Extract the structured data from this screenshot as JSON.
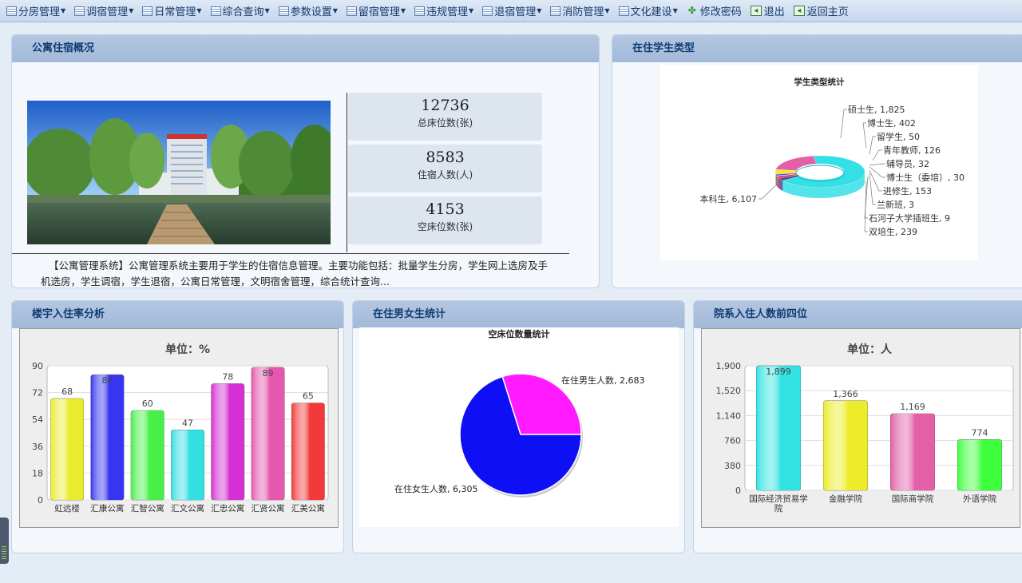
{
  "menu": [
    {
      "label": "分房管理",
      "dropdown": true,
      "icon": "list-icon"
    },
    {
      "label": "调宿管理",
      "dropdown": true,
      "icon": "list-icon"
    },
    {
      "label": "日常管理",
      "dropdown": true,
      "icon": "list-icon"
    },
    {
      "label": "综合查询",
      "dropdown": true,
      "icon": "list-icon"
    },
    {
      "label": "参数设置",
      "dropdown": true,
      "icon": "list-icon"
    },
    {
      "label": "留宿管理",
      "dropdown": true,
      "icon": "list-icon"
    },
    {
      "label": "违规管理",
      "dropdown": true,
      "icon": "list-icon"
    },
    {
      "label": "退宿管理",
      "dropdown": true,
      "icon": "list-icon"
    },
    {
      "label": "消防管理",
      "dropdown": true,
      "icon": "list-icon"
    },
    {
      "label": "文化建设",
      "dropdown": true,
      "icon": "list-icon"
    },
    {
      "label": "修改密码",
      "dropdown": false,
      "icon": "key-icon"
    },
    {
      "label": "退出",
      "dropdown": false,
      "icon": "exit-icon"
    },
    {
      "label": "返回主页",
      "dropdown": false,
      "icon": "home-icon"
    }
  ],
  "overview": {
    "title": "公寓住宿概况",
    "stats": [
      {
        "value": "12736",
        "label": "总床位数(张)"
      },
      {
        "value": "8583",
        "label": "住宿人数(人)"
      },
      {
        "value": "4153",
        "label": "空床位数(张)"
      }
    ],
    "intro": "【公寓管理系统】公寓管理系统主要用于学生的住宿信息管理。主要功能包括：批量学生分房，学生网上选房及手机选房，学生调宿，学生退宿，公寓日常管理，文明宿舍管理，综合统计查询..."
  },
  "student_types": {
    "panel_title": "在住学生类型",
    "chart_title": "学生类型统计",
    "chart_data": {
      "type": "pie",
      "title": "学生类型统计",
      "labels": [
        "硕士生",
        "博士生",
        "留学生",
        "青年教师",
        "辅导员",
        "博士生（委培）",
        "进修生",
        "兰新班",
        "石河子大学插班生",
        "双培生",
        "本科生"
      ],
      "values": [
        1825,
        402,
        50,
        126,
        32,
        30,
        153,
        3,
        9,
        239,
        6107
      ],
      "display": [
        "硕士生, 1,825",
        "博士生, 402",
        "留学生, 50",
        "青年教师, 126",
        "辅导员, 32",
        "博士生（委培）, 30",
        "进修生, 153",
        "兰新班, 3",
        "石河子大学插班生, 9",
        "双培生, 239",
        "本科生, 6,107"
      ],
      "colors": [
        "#e35fa8",
        "#f4ea2a",
        "#ff8c00",
        "#3f3fff",
        "#7dff7d",
        "#b000b0",
        "#ff1010",
        "#2a2a2a",
        "#8c2a2a",
        "#4a4a9a",
        "#35dfe6"
      ]
    }
  },
  "occupancy": {
    "panel_title": "楼宇入住率分析",
    "unit": "单位：%",
    "chart_data": {
      "type": "bar",
      "categories": [
        "虹远楼",
        "汇康公寓",
        "汇智公寓",
        "汇文公寓",
        "汇忠公寓",
        "汇贤公寓",
        "汇美公寓"
      ],
      "values": [
        68,
        84,
        60,
        47,
        78,
        89,
        65
      ],
      "ylim": [
        0,
        90
      ],
      "yticks": [
        "0",
        "18",
        "36",
        "54",
        "72",
        "90"
      ],
      "colors": [
        "#e9ec2e",
        "#3535f2",
        "#49ef49",
        "#33dfe3",
        "#d430d4",
        "#e558ad",
        "#f23a3a"
      ]
    }
  },
  "gender": {
    "panel_title": "在住男女生统计",
    "chart_title": "空床位数量统计",
    "chart_data": {
      "type": "pie",
      "title": "空床位数量统计",
      "labels": [
        "在住男生人数",
        "在住女生人数"
      ],
      "values": [
        2683,
        6305
      ],
      "display": [
        "在住男生人数, 2,683",
        "在住女生人数, 6,305"
      ],
      "colors": [
        "#ff1aff",
        "#0f0ff5"
      ]
    }
  },
  "departments": {
    "panel_title": "院系入住人数前四位",
    "unit": "单位：人",
    "chart_data": {
      "type": "bar",
      "categories": [
        "国际经济贸易学院",
        "金融学院",
        "国际商学院",
        "外语学院"
      ],
      "values": [
        1899,
        1366,
        1169,
        774
      ],
      "display": [
        "1,899",
        "1,366",
        "1,169",
        "774"
      ],
      "ylim": [
        0,
        1900
      ],
      "yticks": [
        "0",
        "380",
        "760",
        "1,140",
        "1,520",
        "1,900"
      ],
      "colors": [
        "#33e3e3",
        "#ecec2a",
        "#e35fa8",
        "#3dff3d"
      ]
    }
  }
}
